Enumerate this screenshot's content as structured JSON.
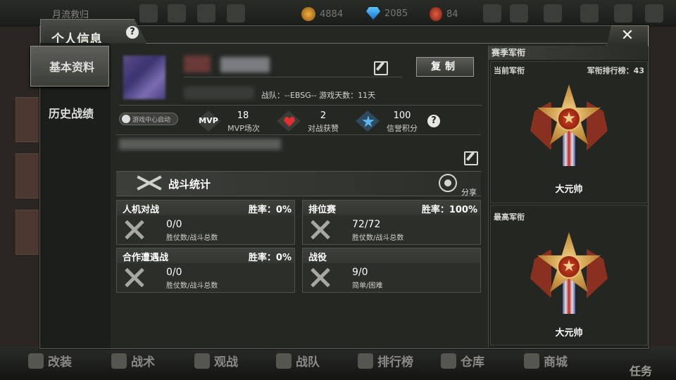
{
  "hud": {
    "player_name": "月流救归",
    "gold": "4884",
    "diamonds": "2085",
    "medals": "84"
  },
  "bottom_nav": [
    {
      "label": "改装",
      "icon": "wrench-icon"
    },
    {
      "label": "战术",
      "icon": "skull-icon"
    },
    {
      "label": "观战",
      "icon": "star-eye-icon"
    },
    {
      "label": "战队",
      "icon": "shield-icon"
    },
    {
      "label": "排行榜",
      "icon": "trophy-icon"
    },
    {
      "label": "仓库",
      "icon": "warehouse-icon"
    },
    {
      "label": "商城",
      "icon": "shop-icon"
    }
  ],
  "task_label": "任务",
  "dialog": {
    "title": "个人信息",
    "help": "?",
    "close": "✕"
  },
  "tabs": {
    "basic": "基本资料",
    "history": "历史战绩"
  },
  "profile": {
    "copy_label": "复制",
    "team_info": "战队：--EBSG--  游戏天数：11天",
    "launch_badge": "游戏中心启动",
    "mvp_badge": "MVP",
    "stats": [
      {
        "value": "18",
        "label": "MVP场次",
        "icon": "mvp-icon"
      },
      {
        "value": "2",
        "label": "对战获赞",
        "icon": "heart-icon"
      },
      {
        "value": "100",
        "label": "信誉积分",
        "icon": "star-icon"
      }
    ],
    "credit_help": "?"
  },
  "battle_stats": {
    "title": "战斗统计",
    "share": "分享",
    "cards": [
      {
        "name": "人机对战",
        "rate": "胜率：0%",
        "value": "0/0",
        "sub": "胜仗数/战斗总数"
      },
      {
        "name": "排位赛",
        "rate": "胜率：100%",
        "value": "72/72",
        "sub": "胜仗数/战斗总数"
      },
      {
        "name": "合作遭遇战",
        "rate": "胜率：0%",
        "value": "0/0",
        "sub": "胜仗数/战斗总数"
      },
      {
        "name": "战役",
        "rate": "",
        "value": "9/0",
        "sub": "简单/困难"
      }
    ]
  },
  "season_rank": {
    "title": "赛季军衔",
    "current_label": "当前军衔",
    "rank_board": "军衔排行榜：43",
    "current_rank": "大元帅",
    "highest_label": "最高军衔",
    "highest_rank": "大元帅"
  },
  "colors": {
    "panel": "#252723",
    "heart": "#e23030",
    "star": "#5ab8f0",
    "badge_gold": "#c08a3a"
  }
}
